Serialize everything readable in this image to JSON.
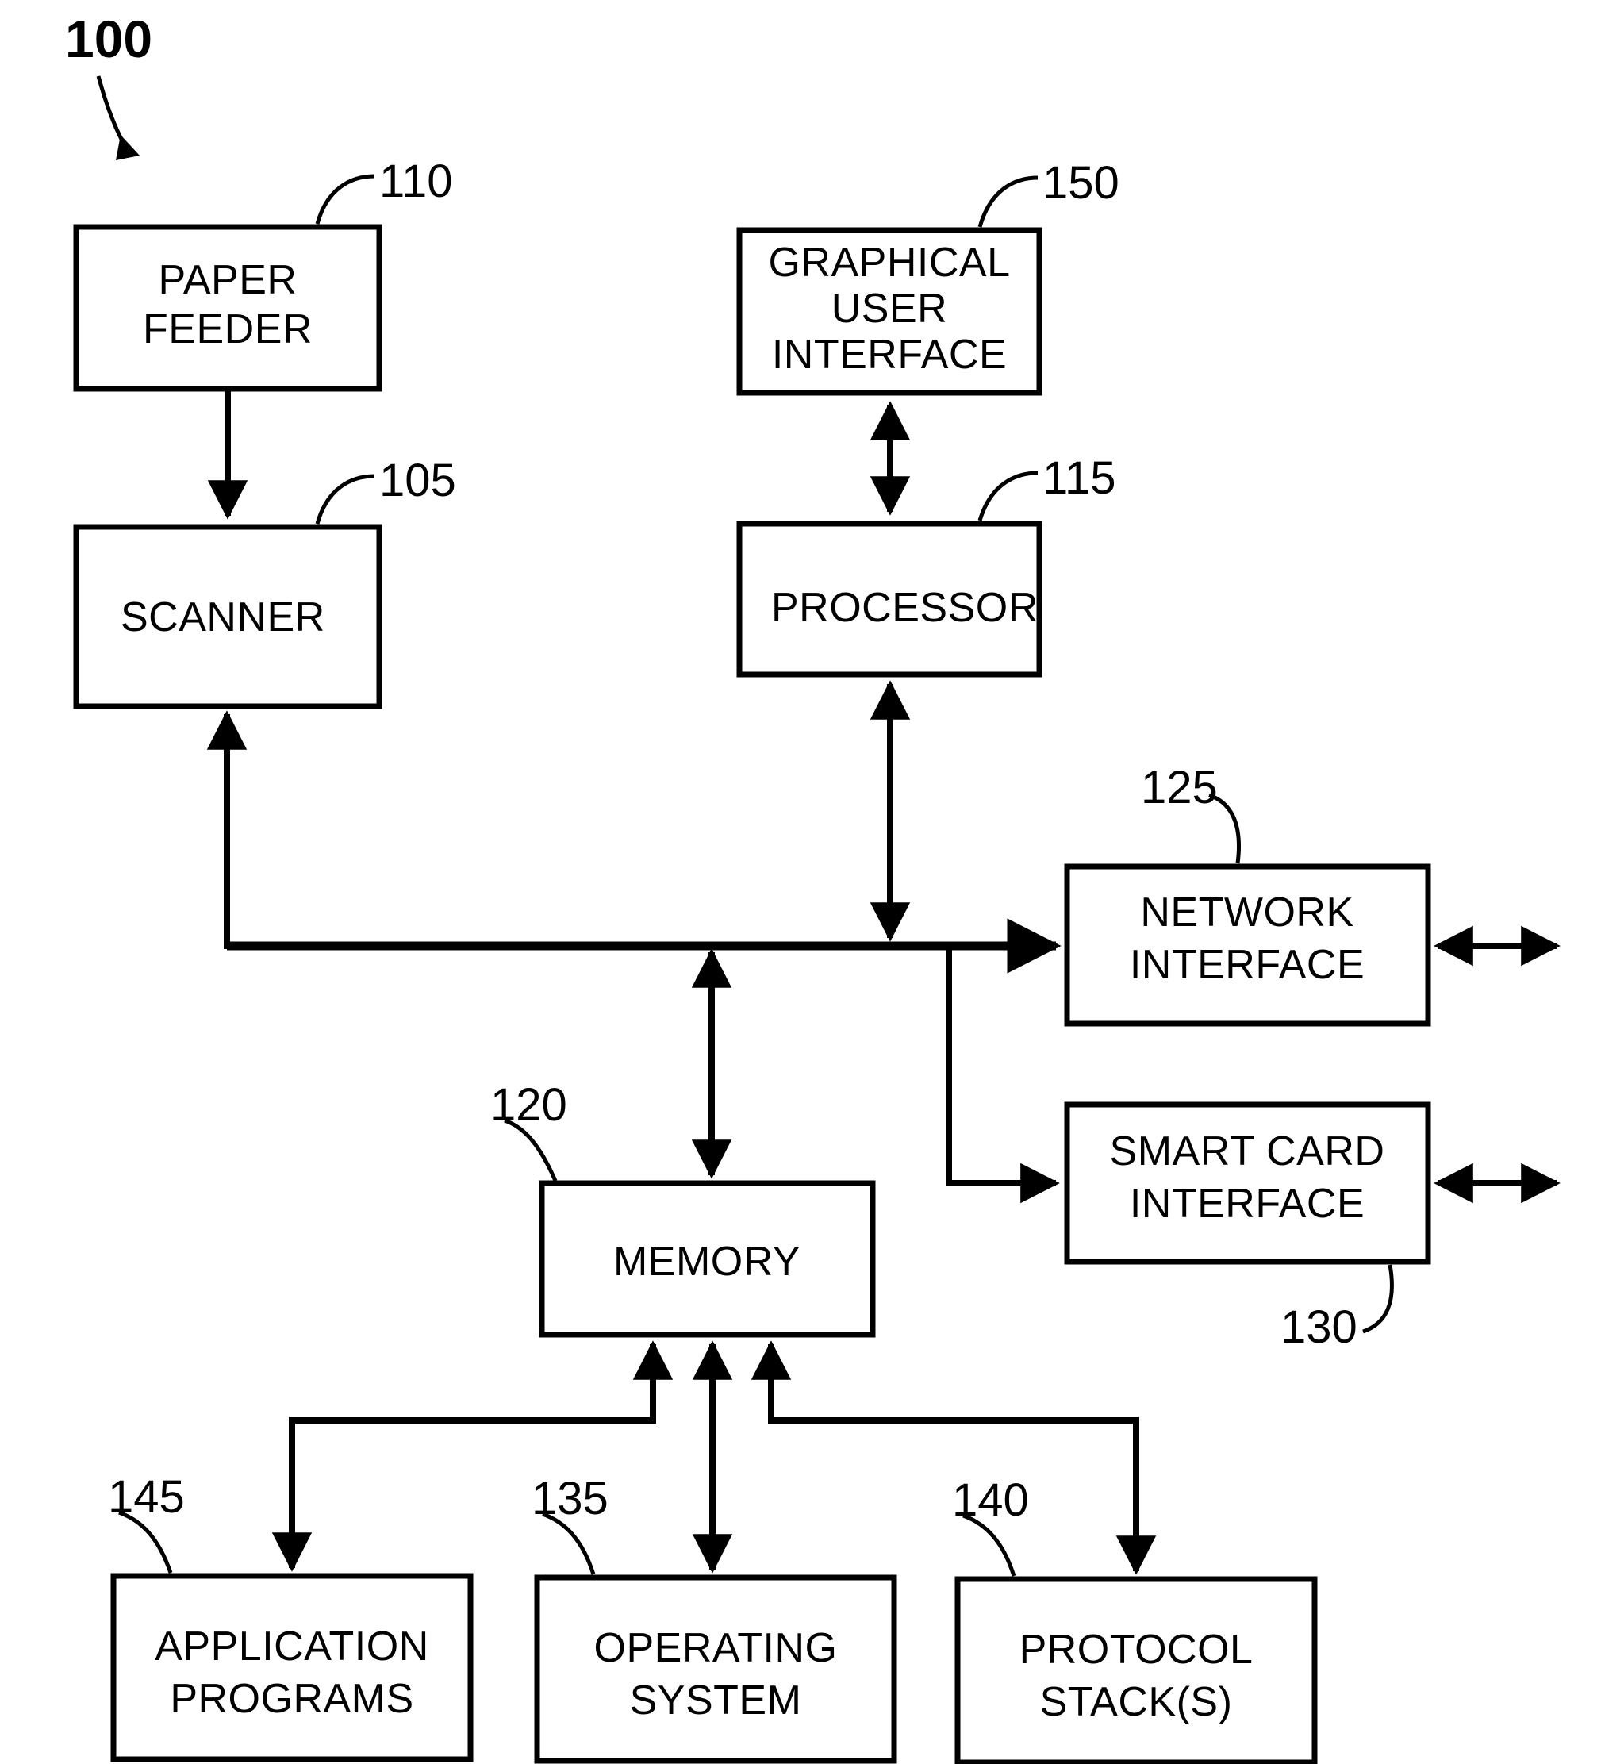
{
  "figure": {
    "number": "100",
    "background": "#ffffff",
    "ink": "#000000"
  },
  "boxes": [
    {
      "id": "paper_feeder",
      "ref": "110",
      "label_line1": "PAPER",
      "label_line2": "FEEDER"
    },
    {
      "id": "scanner",
      "ref": "105",
      "label_line1": "SCANNER",
      "label_line2": ""
    },
    {
      "id": "gui",
      "ref": "150",
      "label_line1": "GRAPHICAL",
      "label_line2": "USER",
      "label_line3": "INTERFACE"
    },
    {
      "id": "processor",
      "ref": "115",
      "label_line1": "PROCESSOR",
      "label_line2": ""
    },
    {
      "id": "network_if",
      "ref": "125",
      "label_line1": "NETWORK",
      "label_line2": "INTERFACE"
    },
    {
      "id": "smartcard_if",
      "ref": "130",
      "label_line1": "SMART CARD",
      "label_line2": "INTERFACE"
    },
    {
      "id": "memory",
      "ref": "120",
      "label_line1": "MEMORY",
      "label_line2": ""
    },
    {
      "id": "app_programs",
      "ref": "145",
      "label_line1": "APPLICATION",
      "label_line2": "PROGRAMS"
    },
    {
      "id": "operating_sys",
      "ref": "135",
      "label_line1": "OPERATING",
      "label_line2": "SYSTEM"
    },
    {
      "id": "protocol_stack",
      "ref": "140",
      "label_line1": "PROTOCOL",
      "label_line2": "STACK(S)"
    }
  ],
  "chart_data": {
    "type": "diagram",
    "title": "System block diagram 100",
    "nodes": [
      "PAPER FEEDER (110)",
      "SCANNER (105)",
      "GRAPHICAL USER INTERFACE (150)",
      "PROCESSOR (115)",
      "NETWORK INTERFACE (125)",
      "SMART CARD INTERFACE (130)",
      "MEMORY (120)",
      "APPLICATION PROGRAMS (145)",
      "OPERATING SYSTEM (135)",
      "PROTOCOL STACK(S) (140)"
    ],
    "edges": [
      {
        "from": "PAPER FEEDER (110)",
        "to": "SCANNER (105)",
        "arrow": "one-way"
      },
      {
        "from": "GRAPHICAL USER INTERFACE (150)",
        "to": "PROCESSOR (115)",
        "arrow": "two-way"
      },
      {
        "from": "PROCESSOR (115)",
        "to": "BUS",
        "arrow": "two-way"
      },
      {
        "from": "SCANNER (105)",
        "to": "BUS",
        "arrow": "one-way-up"
      },
      {
        "from": "BUS",
        "to": "NETWORK INTERFACE (125)",
        "arrow": "one-way"
      },
      {
        "from": "BUS",
        "to": "SMART CARD INTERFACE (130)",
        "arrow": "one-way"
      },
      {
        "from": "MEMORY (120)",
        "to": "BUS",
        "arrow": "two-way"
      },
      {
        "from": "MEMORY (120)",
        "to": "APPLICATION PROGRAMS (145)",
        "arrow": "two-way"
      },
      {
        "from": "MEMORY (120)",
        "to": "OPERATING SYSTEM (135)",
        "arrow": "two-way"
      },
      {
        "from": "MEMORY (120)",
        "to": "PROTOCOL STACK(S) (140)",
        "arrow": "two-way"
      },
      {
        "from": "NETWORK INTERFACE (125)",
        "to": "EXTERNAL",
        "arrow": "two-way"
      },
      {
        "from": "SMART CARD INTERFACE (130)",
        "to": "EXTERNAL",
        "arrow": "two-way"
      }
    ]
  }
}
